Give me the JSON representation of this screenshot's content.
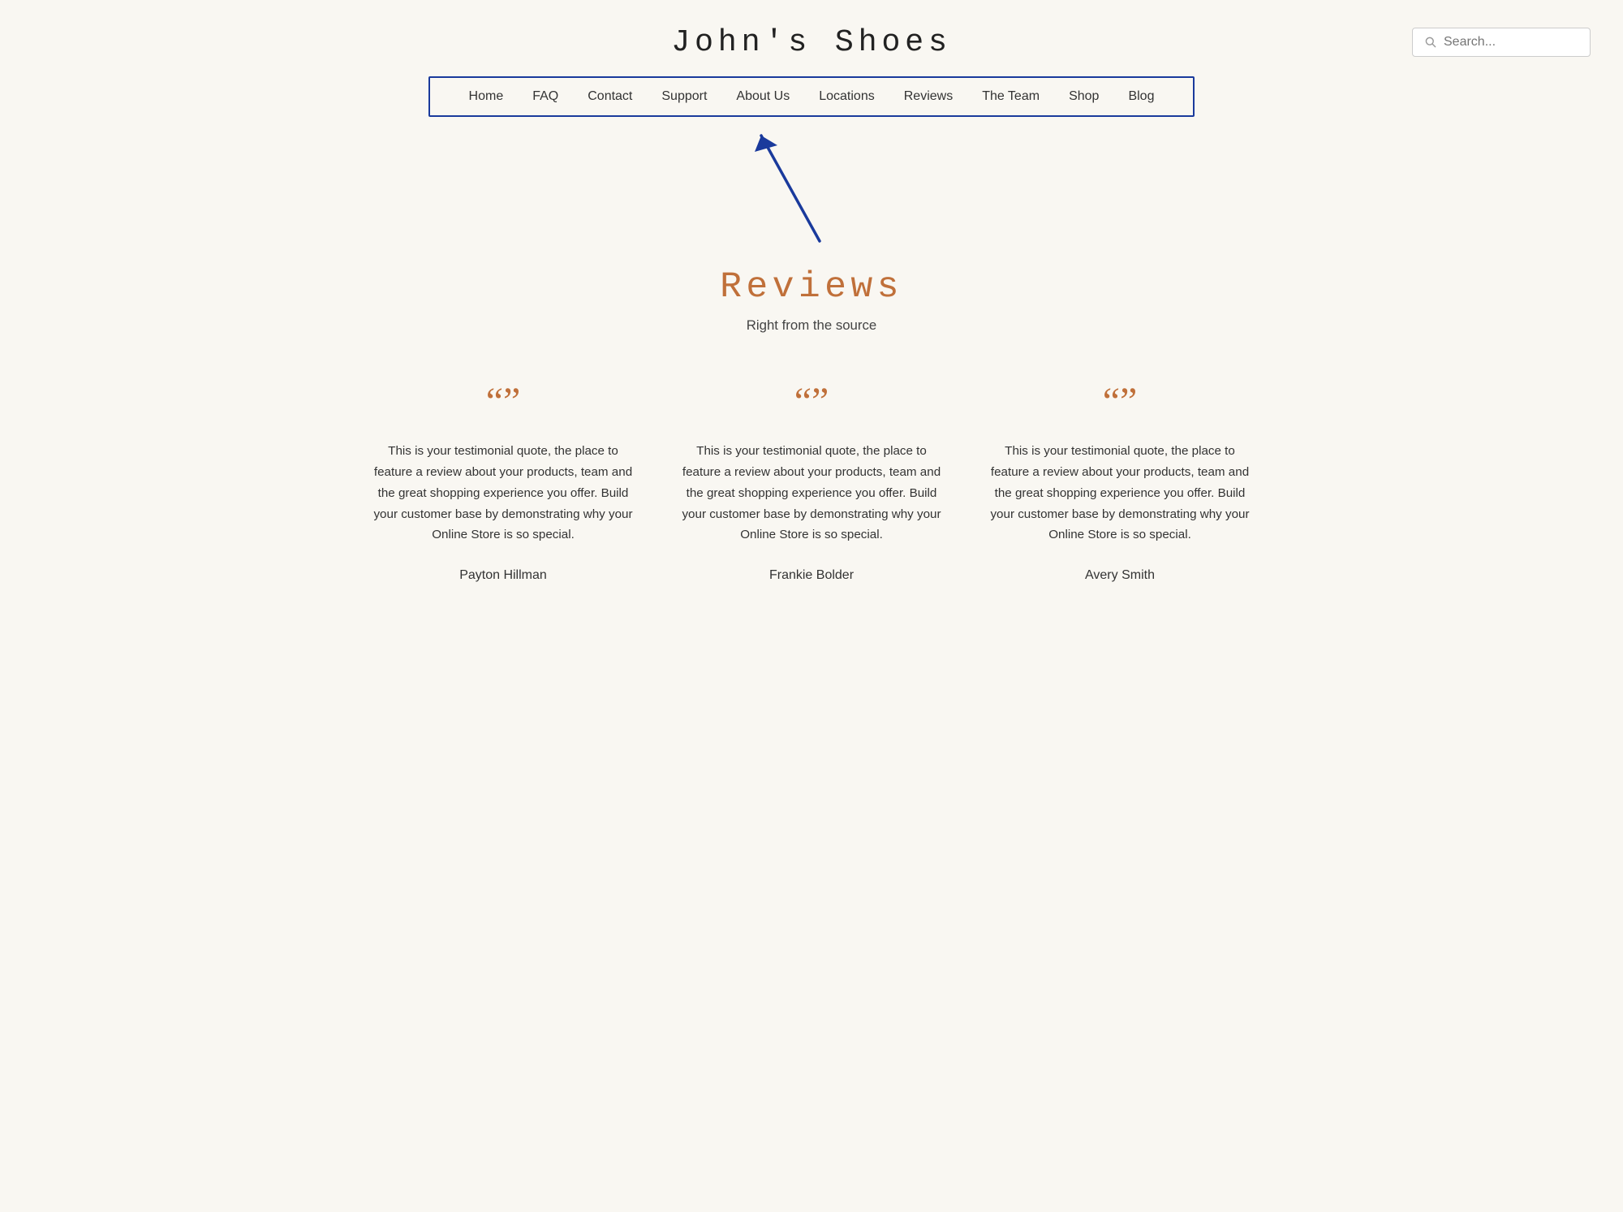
{
  "header": {
    "site_title": "John's Shoes",
    "search_placeholder": "Search..."
  },
  "nav": {
    "items": [
      {
        "label": "Home",
        "href": "#"
      },
      {
        "label": "FAQ",
        "href": "#"
      },
      {
        "label": "Contact",
        "href": "#"
      },
      {
        "label": "Support",
        "href": "#"
      },
      {
        "label": "About Us",
        "href": "#"
      },
      {
        "label": "Locations",
        "href": "#"
      },
      {
        "label": "Reviews",
        "href": "#"
      },
      {
        "label": "The Team",
        "href": "#"
      },
      {
        "label": "Shop",
        "href": "#"
      },
      {
        "label": "Blog",
        "href": "#"
      }
    ]
  },
  "reviews_section": {
    "heading": "Reviews",
    "subtitle": "Right from the source"
  },
  "testimonials": [
    {
      "quote": "This is your testimonial quote, the place to feature a review about your products, team and the great shopping experience you offer. Build your customer base by demonstrating why your Online Store is so special.",
      "author": "Payton Hillman"
    },
    {
      "quote": "This is your testimonial quote, the place to feature a review about your products, team and the great shopping experience you offer. Build your customer base by demonstrating why your Online Store is so special.",
      "author": "Frankie Bolder"
    },
    {
      "quote": "This is your testimonial quote, the place to feature a review about your products, team and the great shopping experience you offer. Build your customer base by demonstrating why your Online Store is so special.",
      "author": "Avery Smith"
    }
  ],
  "colors": {
    "accent": "#c0703a",
    "nav_border": "#1a3a9c",
    "arrow": "#1a3a9c"
  }
}
